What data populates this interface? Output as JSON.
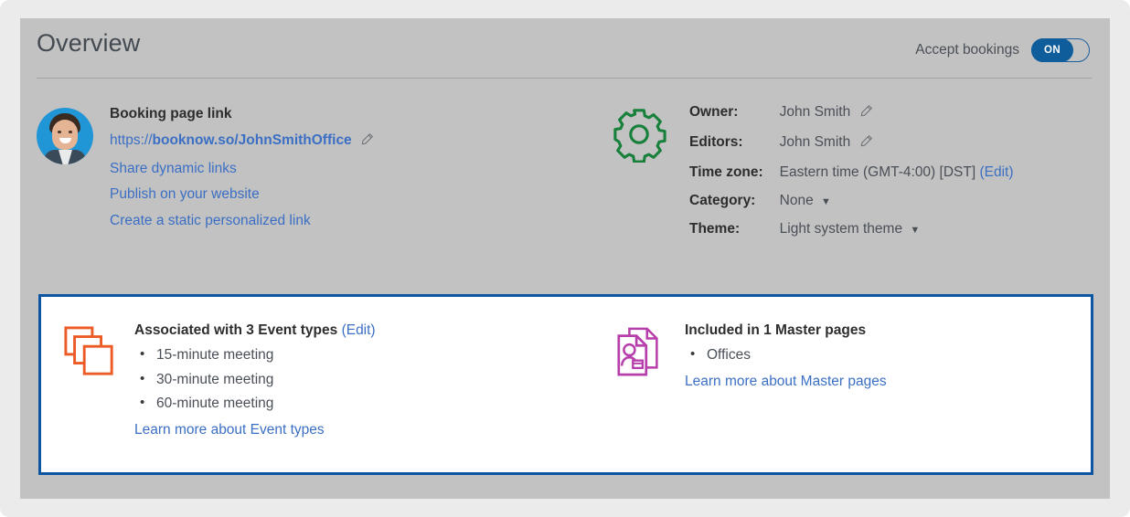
{
  "header": {
    "title": "Overview",
    "accept_bookings_label": "Accept bookings",
    "toggle_state": "ON"
  },
  "booking": {
    "title": "Booking page link",
    "url_scheme": "https://",
    "url_host_path": "booknow.so/JohnSmithOffice",
    "links": [
      "Share dynamic links",
      "Publish on your website",
      "Create a static personalized link"
    ],
    "avatar_name": "John Smith"
  },
  "details": {
    "rows": [
      {
        "key": "Owner:",
        "value": "John Smith",
        "editable": true,
        "edit_label": ""
      },
      {
        "key": "Editors:",
        "value": "John Smith",
        "editable": true,
        "edit_label": ""
      },
      {
        "key": "Time zone:",
        "value": "Eastern time (GMT-4:00) [DST]",
        "editable": false,
        "edit_label": "(Edit)"
      },
      {
        "key": "Category:",
        "value": "None",
        "editable": false,
        "edit_label": ""
      },
      {
        "key": "Theme:",
        "value": "Light system theme",
        "editable": false,
        "edit_label": ""
      }
    ],
    "caret": "▼"
  },
  "event_types": {
    "title": "Associated with 3 Event types",
    "edit_label": "(Edit)",
    "items": [
      "15-minute meeting",
      "30-minute meeting",
      "60-minute meeting"
    ],
    "learn_more": "Learn more about Event types"
  },
  "master_pages": {
    "title": "Included in 1 Master pages",
    "items": [
      "Offices"
    ],
    "learn_more": "Learn more about Master pages"
  },
  "colors": {
    "page_bg": "#ebebeb",
    "card_bg": "#c2c2c2",
    "link_blue": "#3b6fc4",
    "highlight_border": "#0b55a2",
    "toggle_on": "#0f5d9a",
    "gear_green": "#17803a",
    "stack_orange": "#ec5b26",
    "pages_magenta": "#b73fab"
  }
}
